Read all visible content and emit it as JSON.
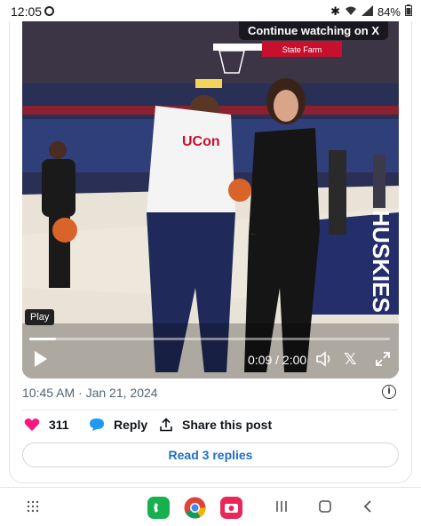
{
  "status_bar": {
    "time": "12:05",
    "battery": "84%"
  },
  "video": {
    "continue_label": "Continue watching on X",
    "play_tooltip": "Play",
    "time_display": "0:09 / 2:00",
    "progress": 0.075,
    "x_logo": "𝕏"
  },
  "post": {
    "timestamp": "10:45 AM · Jan 21, 2024",
    "likes": "311",
    "reply_label": "Reply",
    "share_label": "Share this post",
    "read_replies_label": "Read 3 replies"
  },
  "colors": {
    "heart": "#f91880",
    "reply_bubble": "#1d9bf0",
    "link": "#1d6fc7"
  }
}
